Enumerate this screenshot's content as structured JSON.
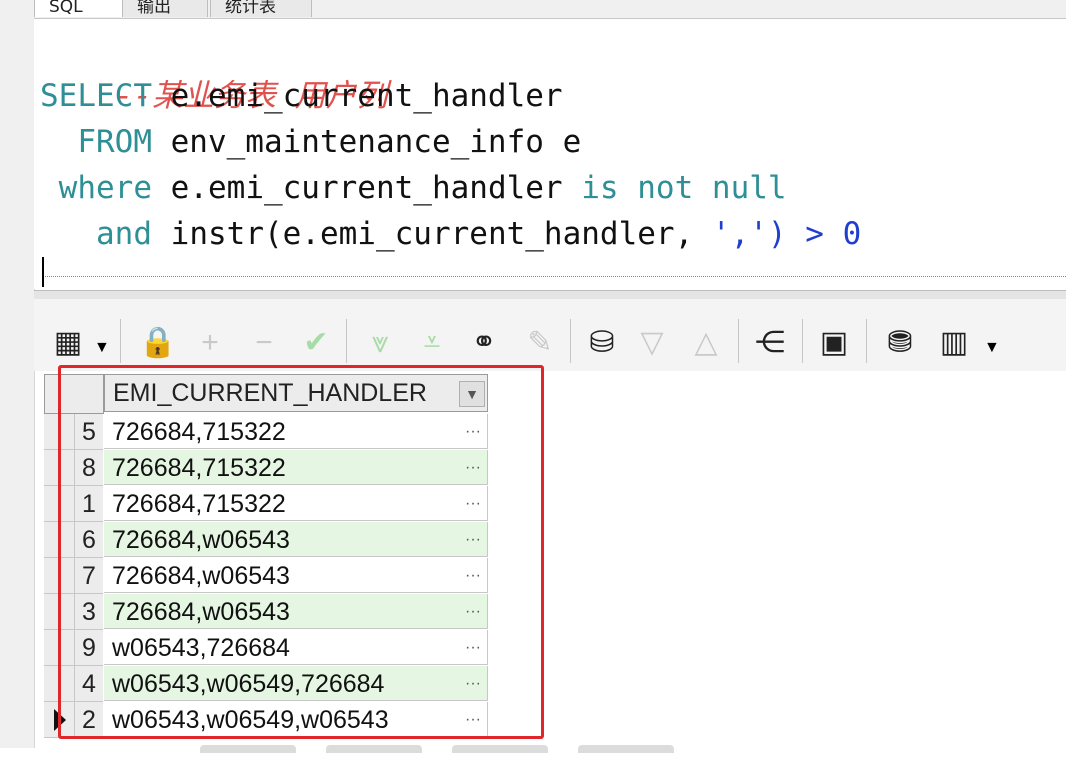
{
  "tabs": [
    {
      "label": "SQL",
      "active": true
    },
    {
      "label": "输出",
      "active": false
    },
    {
      "label": "统计表",
      "active": false
    }
  ],
  "editor": {
    "comment": "--某业务表 用户列",
    "line1": {
      "kw": "SELECT",
      "text": " e.emi_current_handler"
    },
    "line2": {
      "kw": "FROM",
      "text": " env_maintenance_info e"
    },
    "line3": {
      "kw": "where",
      "text": " e.emi_current_handler ",
      "kw2": "is not null"
    },
    "line4": {
      "kw": "and",
      "text": " instr(e.emi_current_handler, ",
      "str": "','",
      "tail": ") > 0"
    }
  },
  "toolbar": {
    "icons": [
      "grid-options-icon",
      "lock-icon",
      "add-record-icon",
      "delete-record-icon",
      "post-changes-icon",
      "next-page-icon",
      "last-page-icon",
      "find-icon",
      "clear-icon",
      "query-by-example-icon",
      "sort-desc-icon",
      "sort-asc-icon",
      "export-tree-icon",
      "save-icon",
      "fetch-db-icon",
      "chart-icon"
    ]
  },
  "grid": {
    "column": "EMI_CURRENT_HANDLER",
    "rows": [
      {
        "num": "5",
        "value": "726684,715322"
      },
      {
        "num": "8",
        "value": "726684,715322"
      },
      {
        "num": "1",
        "value": "726684,715322"
      },
      {
        "num": "6",
        "value": "726684,w06543"
      },
      {
        "num": "7",
        "value": "726684,w06543"
      },
      {
        "num": "3",
        "value": "726684,w06543"
      },
      {
        "num": "9",
        "value": "w06543,726684"
      },
      {
        "num": "4",
        "value": "w06543,w06549,726684"
      },
      {
        "num": "2",
        "value": "w06543,w06549,w06543"
      }
    ],
    "current_row_index": 8,
    "alt_color": "#e5f7e2",
    "cell_button": "···"
  },
  "colors": {
    "highlight": "#e0262a",
    "keyword": "#2f8f96",
    "comment": "#e0524e"
  }
}
